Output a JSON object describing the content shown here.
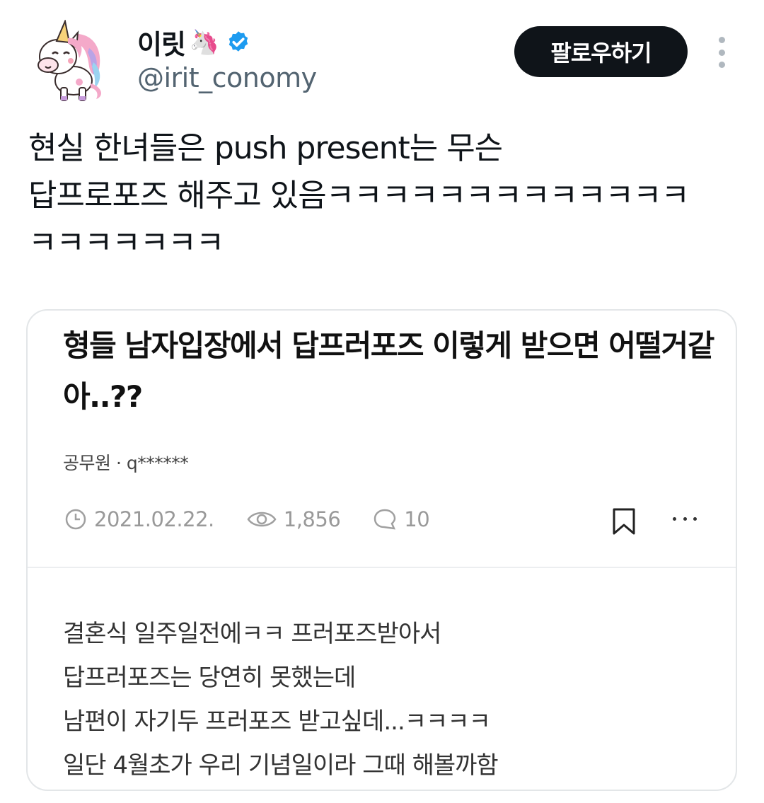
{
  "user": {
    "display_name": "이릿",
    "name_emoji": "🦄",
    "verified_icon": "verified-badge-icon",
    "verified_color": "#1d9bf0",
    "handle": "@irit_conomy"
  },
  "actions": {
    "follow_label": "팔로우하기",
    "more_icon": "more-vertical-icon"
  },
  "tweet": {
    "text": "현실 한녀들은 push present는 무슨\n답프로포즈 해주고 있음ㅋㅋㅋㅋㅋㅋㅋㅋㅋㅋㅋㅋㅋ\nㅋㅋㅋㅋㅋㅋㅋ"
  },
  "card": {
    "title": "형들 남자입장에서 답프러포즈 이렇게 받으면 어떨거같아..??",
    "meta": "공무원 · q******",
    "date": "2021.02.22.",
    "views": "1,856",
    "comments": "10",
    "icons": [
      "clock-icon",
      "eye-icon",
      "comment-icon",
      "bookmark-icon",
      "more-horizontal-icon"
    ],
    "body_lines": [
      "결혼식 일주일전에ㅋㅋ 프러포즈받아서",
      "답프러포즈는 당연히 못했는데",
      "남편이 자기두 프러포즈 받고싶데...ㅋㅋㅋㅋ",
      "일단 4월초가 우리 기념일이라 그때 해볼까함"
    ]
  }
}
